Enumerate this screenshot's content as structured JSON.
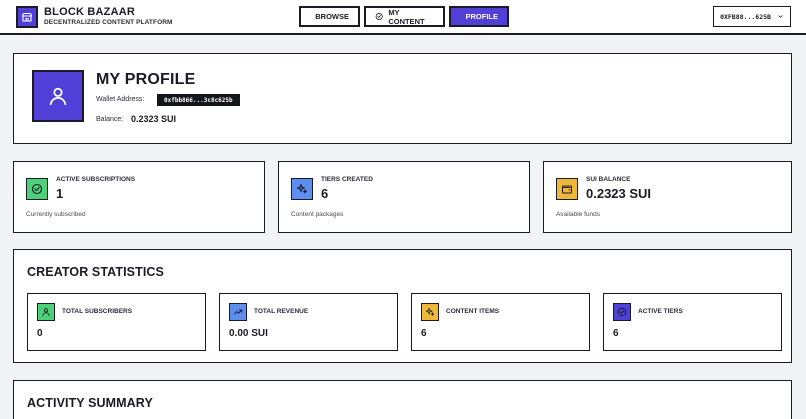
{
  "brand": {
    "title": "BLOCK BAZAAR",
    "subtitle": "DECENTRALIZED CONTENT PLATFORM"
  },
  "nav": {
    "browse": "BROWSE",
    "my_content": "MY CONTENT",
    "profile": "PROFILE",
    "active": "profile"
  },
  "wallet_button": {
    "label": "0XFB88...625B"
  },
  "profile": {
    "title": "MY PROFILE",
    "wallet_label": "Wallet Address:",
    "wallet_value": "0xfbb866...3c8c625b",
    "balance_label": "Balance:",
    "balance_value": "0.2323 SUI"
  },
  "stats": [
    {
      "label": "ACTIVE SUBSCRIPTIONS",
      "value": "1",
      "foot": "Currently subscribed",
      "icon": "check-circle-icon",
      "color": "#4cd07a"
    },
    {
      "label": "TIERS CREATED",
      "value": "6",
      "foot": "Content packages",
      "icon": "sparkles-icon",
      "color": "#5e8ff0"
    },
    {
      "label": "SUI BALANCE",
      "value": "0.2323 SUI",
      "foot": "Available funds",
      "icon": "wallet-icon",
      "color": "#f0b83a"
    }
  ],
  "creator": {
    "title": "CREATOR STATISTICS",
    "items": [
      {
        "label": "TOTAL SUBSCRIBERS",
        "value": "0",
        "icon": "user-icon",
        "color": "#4cd07a"
      },
      {
        "label": "TOTAL REVENUE",
        "value": "0.00 SUI",
        "icon": "trending-up-icon",
        "color": "#5e8ff0"
      },
      {
        "label": "CONTENT ITEMS",
        "value": "6",
        "icon": "sparkles-icon",
        "color": "#f0b83a"
      },
      {
        "label": "ACTIVE TIERS",
        "value": "6",
        "icon": "check-circle-icon",
        "color": "#5140d8"
      }
    ]
  },
  "activity": {
    "title": "ACTIVITY SUMMARY"
  },
  "colors": {
    "accent": "#5140d8",
    "border": "#1a1b24",
    "background": "#f2f3f6"
  }
}
